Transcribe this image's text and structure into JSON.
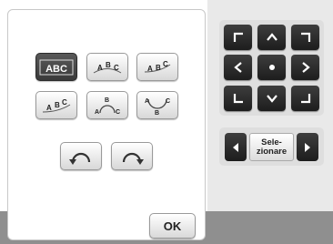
{
  "text_layout_buttons": [
    {
      "label": "ABC",
      "icon": "text-straight-icon",
      "selected": true
    },
    {
      "label": "ABC",
      "icon": "text-arc-up-icon",
      "selected": false
    },
    {
      "label": "ABC",
      "icon": "text-arc-tilted-icon",
      "selected": false
    },
    {
      "label": "ABC",
      "icon": "text-arc-down-icon",
      "selected": false
    },
    {
      "label": "ABC",
      "icon": "text-circle-top-icon",
      "selected": false
    },
    {
      "label": "ABC",
      "icon": "text-circle-bottom-icon",
      "selected": false
    }
  ],
  "rotate_buttons": [
    {
      "icon": "rotate-counterclockwise-icon"
    },
    {
      "icon": "rotate-clockwise-icon"
    }
  ],
  "ok_button": {
    "label": "OK"
  },
  "direction_pad": {
    "buttons": [
      "up-left-icon",
      "up-icon",
      "up-right-icon",
      "left-icon",
      "center-icon",
      "right-icon",
      "down-left-icon",
      "down-icon",
      "down-right-icon"
    ]
  },
  "selector": {
    "label": "Sele-\nzionare",
    "prev_icon": "triangle-left-icon",
    "next_icon": "triangle-right-icon"
  },
  "colors": {
    "selected_button": "#3a3a3a",
    "dark_button": "#1d1d1d",
    "panel_bg": "#e9e9e9",
    "bottom_bar": "#8f8f8f"
  }
}
